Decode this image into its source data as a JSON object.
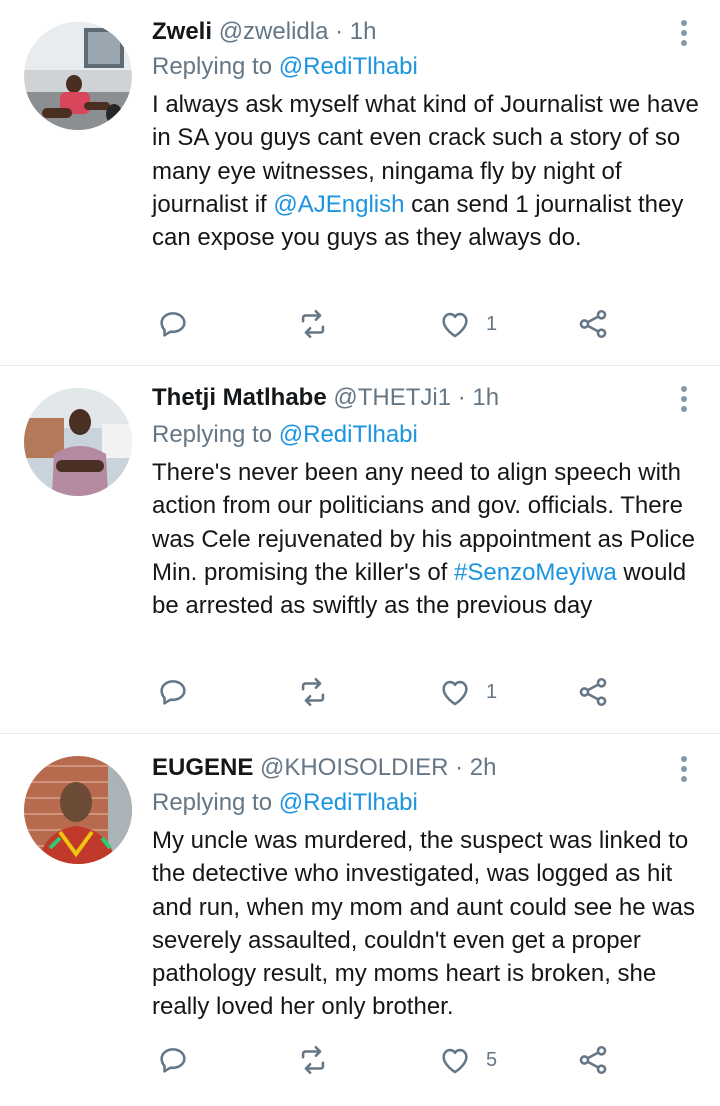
{
  "tweets": [
    {
      "name": "Zweli",
      "handle": "@zwelidla",
      "separator": "·",
      "time": "1h",
      "replying_prefix": "Replying to",
      "replying_to": "@RediTlhabi",
      "text_parts": [
        "I always ask myself what kind of Journalist we have in SA you guys cant even crack such a story of so many eye witnesses, ningama fly by night of journalist if ",
        "@AJEnglish",
        " can send 1 journalist they can expose you guys as they always do."
      ],
      "like_count": "1"
    },
    {
      "name": "Thetji Matlhabe",
      "handle": "@THETJi1",
      "separator": "·",
      "time": "1h",
      "replying_prefix": "Replying to",
      "replying_to": "@RediTlhabi",
      "text_parts": [
        "There's never been any need to align speech with action from our politicians and gov. officials. There was Cele rejuvenated by his appointment as Police Min. promising the killer's of ",
        "#SenzoMeyiwa",
        " would be arrested as swiftly as the previous day"
      ],
      "like_count": "1"
    },
    {
      "name": "EUGENE",
      "handle": "@KHOISOLDIER",
      "separator": "·",
      "time": "2h",
      "replying_prefix": "Replying to",
      "replying_to": "@RediTlhabi",
      "text_parts": [
        "My uncle was murdered, the suspect was linked to the detective who investigated, was logged as hit and run, when my mom and aunt could see he was severely assaulted, couldn't even get a proper pathology result, my moms heart is broken, she really loved her only brother."
      ],
      "like_count": "5"
    }
  ],
  "colors": {
    "link": "#1b95e0",
    "secondary_text": "#657786",
    "primary_text": "#14171a",
    "icon": "#657786",
    "divider": "#e6ecf0"
  },
  "icons": [
    "reply-icon",
    "retweet-icon",
    "like-icon",
    "share-icon",
    "more-options-icon"
  ]
}
